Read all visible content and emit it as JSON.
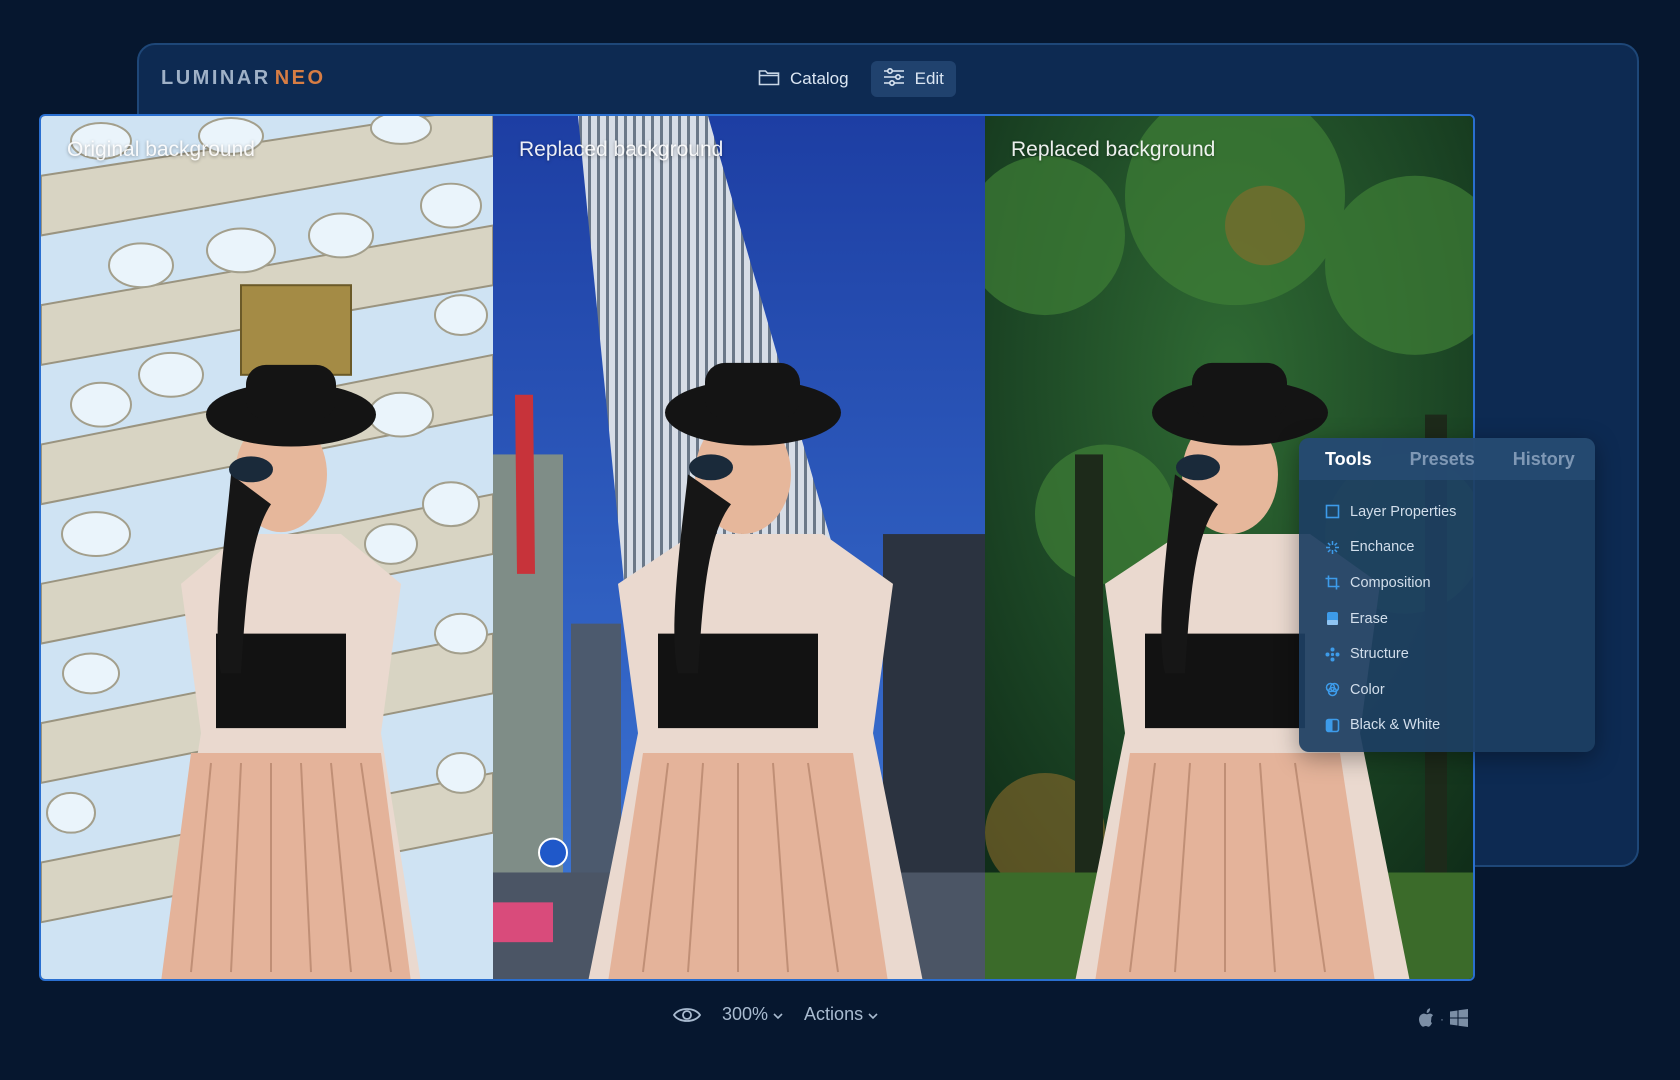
{
  "app": {
    "logo_part1": "LUMINAR",
    "logo_part2": "NEO",
    "brand_color": "#d77d44"
  },
  "nav": {
    "catalog_label": "Catalog",
    "catalog_icon": "folder-icon",
    "edit_label": "Edit",
    "edit_icon": "sliders-icon",
    "active": "Edit"
  },
  "panels": [
    {
      "label": "Original background"
    },
    {
      "label": "Replaced background"
    },
    {
      "label": "Replaced background"
    }
  ],
  "tools_panel": {
    "tabs": [
      "Tools",
      "Presets",
      "History"
    ],
    "active_tab": "Tools",
    "items": [
      {
        "label": "Layer Properties",
        "icon": "square-icon"
      },
      {
        "label": "Enchance",
        "icon": "sparkle-icon"
      },
      {
        "label": "Composition",
        "icon": "crop-icon"
      },
      {
        "label": "Erase",
        "icon": "eraser-icon"
      },
      {
        "label": "Structure",
        "icon": "structure-icon"
      },
      {
        "label": "Color",
        "icon": "color-circles-icon"
      },
      {
        "label": "Black & White",
        "icon": "half-square-icon"
      }
    ],
    "accent_color": "#3d9be9"
  },
  "bottom_bar": {
    "zoom": "300%",
    "actions_label": "Actions",
    "eye_icon": "eye-icon",
    "os_icons": [
      "apple-icon",
      "windows-icon"
    ],
    "os_separator": "·"
  }
}
